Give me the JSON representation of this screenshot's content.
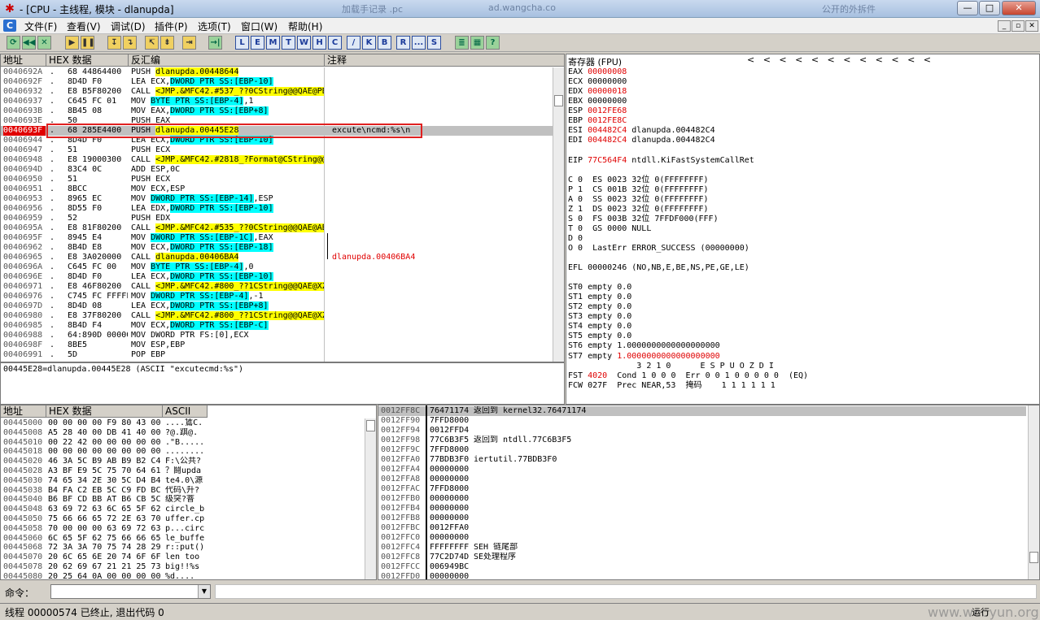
{
  "window": {
    "title": "- [CPU - 主线程, 模块 - dlanupda]",
    "ghost_tabs": [
      "加载手记录 .pc",
      "ad.wangcha.co",
      "公开的外拆件"
    ],
    "btn_min": "—",
    "btn_max": "□",
    "btn_close": "✕"
  },
  "menu": {
    "icon": "C",
    "items": [
      "文件(F)",
      "查看(V)",
      "调试(D)",
      "插件(P)",
      "选项(T)",
      "窗口(W)",
      "帮助(H)"
    ],
    "mdi": [
      "_",
      "▫",
      "✕"
    ]
  },
  "toolbar": {
    "buttons": [
      "⟳",
      "◀◀",
      "✕",
      "▶",
      "❚❚",
      "↧",
      "↴",
      "↸",
      "⇟",
      "⇥",
      "→|"
    ],
    "letters": [
      "L",
      "E",
      "M",
      "T",
      "W",
      "H",
      "C",
      "/",
      "K",
      "B",
      "R",
      "...",
      "S"
    ],
    "extra": [
      "≣",
      "▦",
      "?"
    ]
  },
  "disasm": {
    "headers": [
      "地址",
      "HEX 数据",
      "反汇编",
      "注释"
    ],
    "rows": [
      {
        "addr": "0040692A",
        "m": ".",
        "hex": "68 44864400",
        "pre": "PUSH ",
        "hl": "dlanupda.00448644",
        "hlc": "y",
        "post": "",
        "cmt": ""
      },
      {
        "addr": "0040692F",
        "m": ".",
        "hex": "8D4D F0",
        "pre": "LEA ECX,",
        "hl": "DWORD PTR SS:[EBP-10]",
        "hlc": "c",
        "post": "",
        "cmt": ""
      },
      {
        "addr": "00406932",
        "m": ".",
        "hex": "E8 B5F80200",
        "pre": "CALL ",
        "hl": "<JMP.&MFC42.#537_??0CString@@QAE@PBD@Z>",
        "hlc": "y",
        "post": "",
        "cmt": ""
      },
      {
        "addr": "00406937",
        "m": ".",
        "hex": "C645 FC 01",
        "pre": "MOV ",
        "hl": "BYTE PTR SS:[EBP-4]",
        "hlc": "c",
        "post": ",1",
        "cmt": ""
      },
      {
        "addr": "0040693B",
        "m": ".",
        "hex": "8B45 08",
        "pre": "MOV EAX,",
        "hl": "DWORD PTR SS:[EBP+8]",
        "hlc": "c",
        "post": "",
        "cmt": ""
      },
      {
        "addr": "0040693E",
        "m": ".",
        "hex": "50",
        "pre": "PUSH EAX",
        "hl": "",
        "hlc": "",
        "post": "",
        "cmt": ""
      },
      {
        "addr": "0040693F",
        "m": ".",
        "hex": "68 285E4400",
        "pre": "PUSH ",
        "hl": "dlanupda.00445E28",
        "hlc": "y",
        "post": "",
        "cmt": "excute\\ncmd:%s\\n",
        "sel": true
      },
      {
        "addr": "00406944",
        "m": ".",
        "hex": "8D4D F0",
        "pre": "LEA ECX,",
        "hl": "DWORD PTR SS:[EBP-10]",
        "hlc": "c",
        "post": "",
        "cmt": ""
      },
      {
        "addr": "00406947",
        "m": ".",
        "hex": "51",
        "pre": "PUSH ECX",
        "hl": "",
        "hlc": "",
        "post": "",
        "cmt": ""
      },
      {
        "addr": "00406948",
        "m": ".",
        "hex": "E8 19000300",
        "pre": "CALL ",
        "hl": "<JMP.&MFC42.#2818_?Format@CString@@QAAXPBDZZ>",
        "hlc": "y",
        "post": "",
        "cmt": ""
      },
      {
        "addr": "0040694D",
        "m": ".",
        "hex": "83C4 0C",
        "pre": "ADD ESP,0C",
        "hl": "",
        "hlc": "",
        "post": "",
        "cmt": ""
      },
      {
        "addr": "00406950",
        "m": ".",
        "hex": "51",
        "pre": "PUSH ECX",
        "hl": "",
        "hlc": "",
        "post": "",
        "cmt": ""
      },
      {
        "addr": "00406951",
        "m": ".",
        "hex": "8BCC",
        "pre": "MOV ECX,ESP",
        "hl": "",
        "hlc": "",
        "post": "",
        "cmt": ""
      },
      {
        "addr": "00406953",
        "m": ".",
        "hex": "8965 EC",
        "pre": "MOV ",
        "hl": "DWORD PTR SS:[EBP-14]",
        "hlc": "c",
        "post": ",ESP",
        "cmt": ""
      },
      {
        "addr": "00406956",
        "m": ".",
        "hex": "8D55 F0",
        "pre": "LEA EDX,",
        "hl": "DWORD PTR SS:[EBP-10]",
        "hlc": "c",
        "post": "",
        "cmt": ""
      },
      {
        "addr": "00406959",
        "m": ".",
        "hex": "52",
        "pre": "PUSH EDX",
        "hl": "",
        "hlc": "",
        "post": "",
        "cmt": ""
      },
      {
        "addr": "0040695A",
        "m": ".",
        "hex": "E8 81F80200",
        "pre": "CALL ",
        "hl": "<JMP.&MFC42.#535_??0CString@@QAE@ABV0@@Z>",
        "hlc": "y",
        "post": "",
        "cmt": ""
      },
      {
        "addr": "0040695F",
        "m": ".",
        "hex": "8945 E4",
        "pre": "MOV ",
        "hl": "DWORD PTR SS:[EBP-1C]",
        "hlc": "c",
        "post": ",EAX",
        "cmt": ""
      },
      {
        "addr": "00406962",
        "m": ".",
        "hex": "8B4D E8",
        "pre": "MOV ECX,",
        "hl": "DWORD PTR SS:[EBP-18]",
        "hlc": "c",
        "post": "",
        "cmt": ""
      },
      {
        "addr": "00406965",
        "m": ".",
        "hex": "E8 3A020000",
        "pre": "CALL ",
        "hl": "dlanupda.00406BA4",
        "hlc": "y",
        "post": "",
        "cmt": "dlanupda.00406BA4",
        "cmtred": true
      },
      {
        "addr": "0040696A",
        "m": ".",
        "hex": "C645 FC 00",
        "pre": "MOV ",
        "hl": "BYTE PTR SS:[EBP-4]",
        "hlc": "c",
        "post": ",0",
        "cmt": ""
      },
      {
        "addr": "0040696E",
        "m": ".",
        "hex": "8D4D F0",
        "pre": "LEA ECX,",
        "hl": "DWORD PTR SS:[EBP-10]",
        "hlc": "c",
        "post": "",
        "cmt": ""
      },
      {
        "addr": "00406971",
        "m": ".",
        "hex": "E8 46F80200",
        "pre": "CALL ",
        "hl": "<JMP.&MFC42.#800_??1CString@@QAE@XZ>",
        "hlc": "y",
        "post": "",
        "cmt": ""
      },
      {
        "addr": "00406976",
        "m": ".",
        "hex": "C745 FC FFFFFFFF",
        "pre": "MOV ",
        "hl": "DWORD PTR SS:[EBP-4]",
        "hlc": "c",
        "post": ",-1",
        "cmt": ""
      },
      {
        "addr": "0040697D",
        "m": ".",
        "hex": "8D4D 08",
        "pre": "LEA ECX,",
        "hl": "DWORD PTR SS:[EBP+8]",
        "hlc": "c",
        "post": "",
        "cmt": ""
      },
      {
        "addr": "00406980",
        "m": ".",
        "hex": "E8 37F80200",
        "pre": "CALL ",
        "hl": "<JMP.&MFC42.#800_??1CString@@QAE@XZ>",
        "hlc": "y",
        "post": "",
        "cmt": ""
      },
      {
        "addr": "00406985",
        "m": ".",
        "hex": "8B4D F4",
        "pre": "MOV ECX,",
        "hl": "DWORD PTR SS:[EBP-C]",
        "hlc": "c",
        "post": "",
        "cmt": ""
      },
      {
        "addr": "00406988",
        "m": ".",
        "hex": "64:890D 00000000",
        "pre": "MOV DWORD PTR FS:[0],ECX",
        "hl": "",
        "hlc": "",
        "post": "",
        "cmt": ""
      },
      {
        "addr": "0040698F",
        "m": ".",
        "hex": "8BE5",
        "pre": "MOV ESP,EBP",
        "hl": "",
        "hlc": "",
        "post": "",
        "cmt": ""
      },
      {
        "addr": "00406991",
        "m": ".",
        "hex": "5D",
        "pre": "POP EBP",
        "hl": "",
        "hlc": "",
        "post": "",
        "cmt": ""
      }
    ],
    "info": "00445E28=dlanupda.00445E28 (ASCII \"excutecmd:%s\")"
  },
  "registers": {
    "title": "寄存器 (FPU)",
    "arrows": "<   <   <   <   <   <   <   <   <   <   <   <",
    "lines": [
      {
        "t": "EAX ",
        "v": "00000008",
        "red": true,
        "r": ""
      },
      {
        "t": "ECX ",
        "v": "00000000",
        "red": false,
        "r": ""
      },
      {
        "t": "EDX ",
        "v": "00000018",
        "red": true,
        "r": ""
      },
      {
        "t": "EBX ",
        "v": "00000000",
        "red": false,
        "r": ""
      },
      {
        "t": "ESP ",
        "v": "0012FE68",
        "red": true,
        "r": ""
      },
      {
        "t": "EBP ",
        "v": "0012FE8C",
        "red": true,
        "r": ""
      },
      {
        "t": "ESI ",
        "v": "004482C4",
        "red": true,
        "r": " dlanupda.004482C4"
      },
      {
        "t": "EDI ",
        "v": "004482C4",
        "red": true,
        "r": " dlanupda.004482C4"
      },
      {
        "t": "",
        "v": "",
        "red": false,
        "r": ""
      },
      {
        "t": "EIP ",
        "v": "77C564F4",
        "red": true,
        "r": " ntdll.KiFastSystemCallRet"
      },
      {
        "t": "",
        "v": "",
        "red": false,
        "r": ""
      },
      {
        "t": "C 0  ES 0023 32位 0(FFFFFFFF)",
        "v": "",
        "red": false,
        "r": ""
      },
      {
        "t": "P 1  CS 001B 32位 0(FFFFFFFF)",
        "v": "",
        "red": false,
        "r": ""
      },
      {
        "t": "A 0  SS 0023 32位 0(FFFFFFFF)",
        "v": "",
        "red": false,
        "r": ""
      },
      {
        "t": "Z 1  DS 0023 32位 0(FFFFFFFF)",
        "v": "",
        "red": false,
        "r": ""
      },
      {
        "t": "S 0  FS 003B 32位 7FFDF000(FFF)",
        "v": "",
        "red": false,
        "r": ""
      },
      {
        "t": "T 0  GS 0000 NULL",
        "v": "",
        "red": false,
        "r": ""
      },
      {
        "t": "D 0",
        "v": "",
        "red": false,
        "r": ""
      },
      {
        "t": "O 0  LastErr ERROR_SUCCESS (00000000)",
        "v": "",
        "red": false,
        "r": ""
      },
      {
        "t": "",
        "v": "",
        "red": false,
        "r": ""
      },
      {
        "t": "EFL 00000246 (NO,NB,E,BE,NS,PE,GE,LE)",
        "v": "",
        "red": false,
        "r": ""
      },
      {
        "t": "",
        "v": "",
        "red": false,
        "r": ""
      },
      {
        "t": "ST0 empty 0.0",
        "v": "",
        "red": false,
        "r": ""
      },
      {
        "t": "ST1 empty 0.0",
        "v": "",
        "red": false,
        "r": ""
      },
      {
        "t": "ST2 empty 0.0",
        "v": "",
        "red": false,
        "r": ""
      },
      {
        "t": "ST3 empty 0.0",
        "v": "",
        "red": false,
        "r": ""
      },
      {
        "t": "ST4 empty 0.0",
        "v": "",
        "red": false,
        "r": ""
      },
      {
        "t": "ST5 empty 0.0",
        "v": "",
        "red": false,
        "r": ""
      },
      {
        "t": "ST6 empty 1.0000000000000000000",
        "v": "",
        "red": false,
        "r": ""
      },
      {
        "t": "ST7 empty ",
        "v": "1.0000000000000000000",
        "red": true,
        "r": ""
      },
      {
        "t": "              3 2 1 0      E S P U O Z D I",
        "v": "",
        "red": false,
        "r": ""
      },
      {
        "t": "FST ",
        "v": "4020",
        "red": true,
        "r": "  Cond 1 0 0 0  Err 0 0 1 0 0 0 0 0  (EQ)"
      },
      {
        "t": "FCW 027F  Prec NEAR,53  掩码    1 1 1 1 1 1",
        "v": "",
        "red": false,
        "r": ""
      }
    ]
  },
  "dump": {
    "headers": [
      "地址",
      "HEX 数据",
      "ASCII"
    ],
    "rows": [
      [
        "00445000",
        "00 00 00 00 F9 80 43 00",
        "....鵀C."
      ],
      [
        "00445008",
        "A5 28 40 00 DB 41 40 00",
        "?@.踑@."
      ],
      [
        "00445010",
        "00 22 42 00 00 00 00 00",
        ".\"B....."
      ],
      [
        "00445018",
        "00 00 00 00 00 00 00 00",
        "........"
      ],
      [
        "00445020",
        "46 3A 5C B9 AB B9 B2 C4",
        "F:\\公共?"
      ],
      [
        "00445028",
        "A3 BF E9 5C 75 70 64 61",
        "？鬪upda"
      ],
      [
        "00445030",
        "74 65 34 2E 30 5C D4 B4",
        "te4.0\\源"
      ],
      [
        "00445038",
        "B4 FA C2 EB 5C C9 FD BC",
        "代码\\升?"
      ],
      [
        "00445040",
        "B6 BF CD BB AT B6 CB 5C",
        "级突?萻"
      ],
      [
        "00445048",
        "63 69 72 63 6C 65 5F 62",
        "circle_b"
      ],
      [
        "00445050",
        "75 66 66 65 72 2E 63 70",
        "uffer.cp"
      ],
      [
        "00445058",
        "70 00 00 00 63 69 72 63",
        "p...circ"
      ],
      [
        "00445060",
        "6C 65 5F 62 75 66 66 65",
        "le_buffe"
      ],
      [
        "00445068",
        "72 3A 3A 70 75 74 28 29",
        "r::put()"
      ],
      [
        "00445070",
        "20 6C 65 6E 20 74 6F 6F",
        " len too"
      ],
      [
        "00445078",
        "20 62 69 67 21 21 25 73",
        " big!!%s"
      ],
      [
        "00445080",
        "20 25 64 0A 00 00 00 00",
        " %d...."
      ]
    ]
  },
  "stack": {
    "rows": [
      [
        "0012FF8C",
        "76471174",
        "返回到 kernel32.76471174"
      ],
      [
        "0012FF90",
        "7FFD8000",
        ""
      ],
      [
        "0012FF94",
        "0012FFD4",
        ""
      ],
      [
        "0012FF98",
        "77C6B3F5",
        "返回到 ntdll.77C6B3F5"
      ],
      [
        "0012FF9C",
        "7FFD8000",
        ""
      ],
      [
        "0012FFA0",
        "77BDB3F0",
        "iertutil.77BDB3F0"
      ],
      [
        "0012FFA4",
        "00000000",
        ""
      ],
      [
        "0012FFA8",
        "00000000",
        ""
      ],
      [
        "0012FFAC",
        "7FFD8000",
        ""
      ],
      [
        "0012FFB0",
        "00000000",
        ""
      ],
      [
        "0012FFB4",
        "00000000",
        ""
      ],
      [
        "0012FFB8",
        "00000000",
        ""
      ],
      [
        "0012FFBC",
        "0012FFA0",
        ""
      ],
      [
        "0012FFC0",
        "00000000",
        ""
      ],
      [
        "0012FFC4",
        "FFFFFFFF",
        "SEH 链尾部"
      ],
      [
        "0012FFC8",
        "77C2D74D",
        "SE处理程序"
      ],
      [
        "0012FFCC",
        "006949BC",
        ""
      ],
      [
        "0012FFD0",
        "00000000",
        ""
      ]
    ]
  },
  "command": {
    "label": "命令："
  },
  "status": {
    "text": "线程 00000574 已终止, 退出代码 0",
    "right": "运行",
    "watermark": "www.wooyun.org"
  },
  "colors": {
    "highlight_yellow": "#ffff00",
    "highlight_cyan": "#00ffff",
    "red_box": "#e02020",
    "changed_red": "#e00000"
  }
}
